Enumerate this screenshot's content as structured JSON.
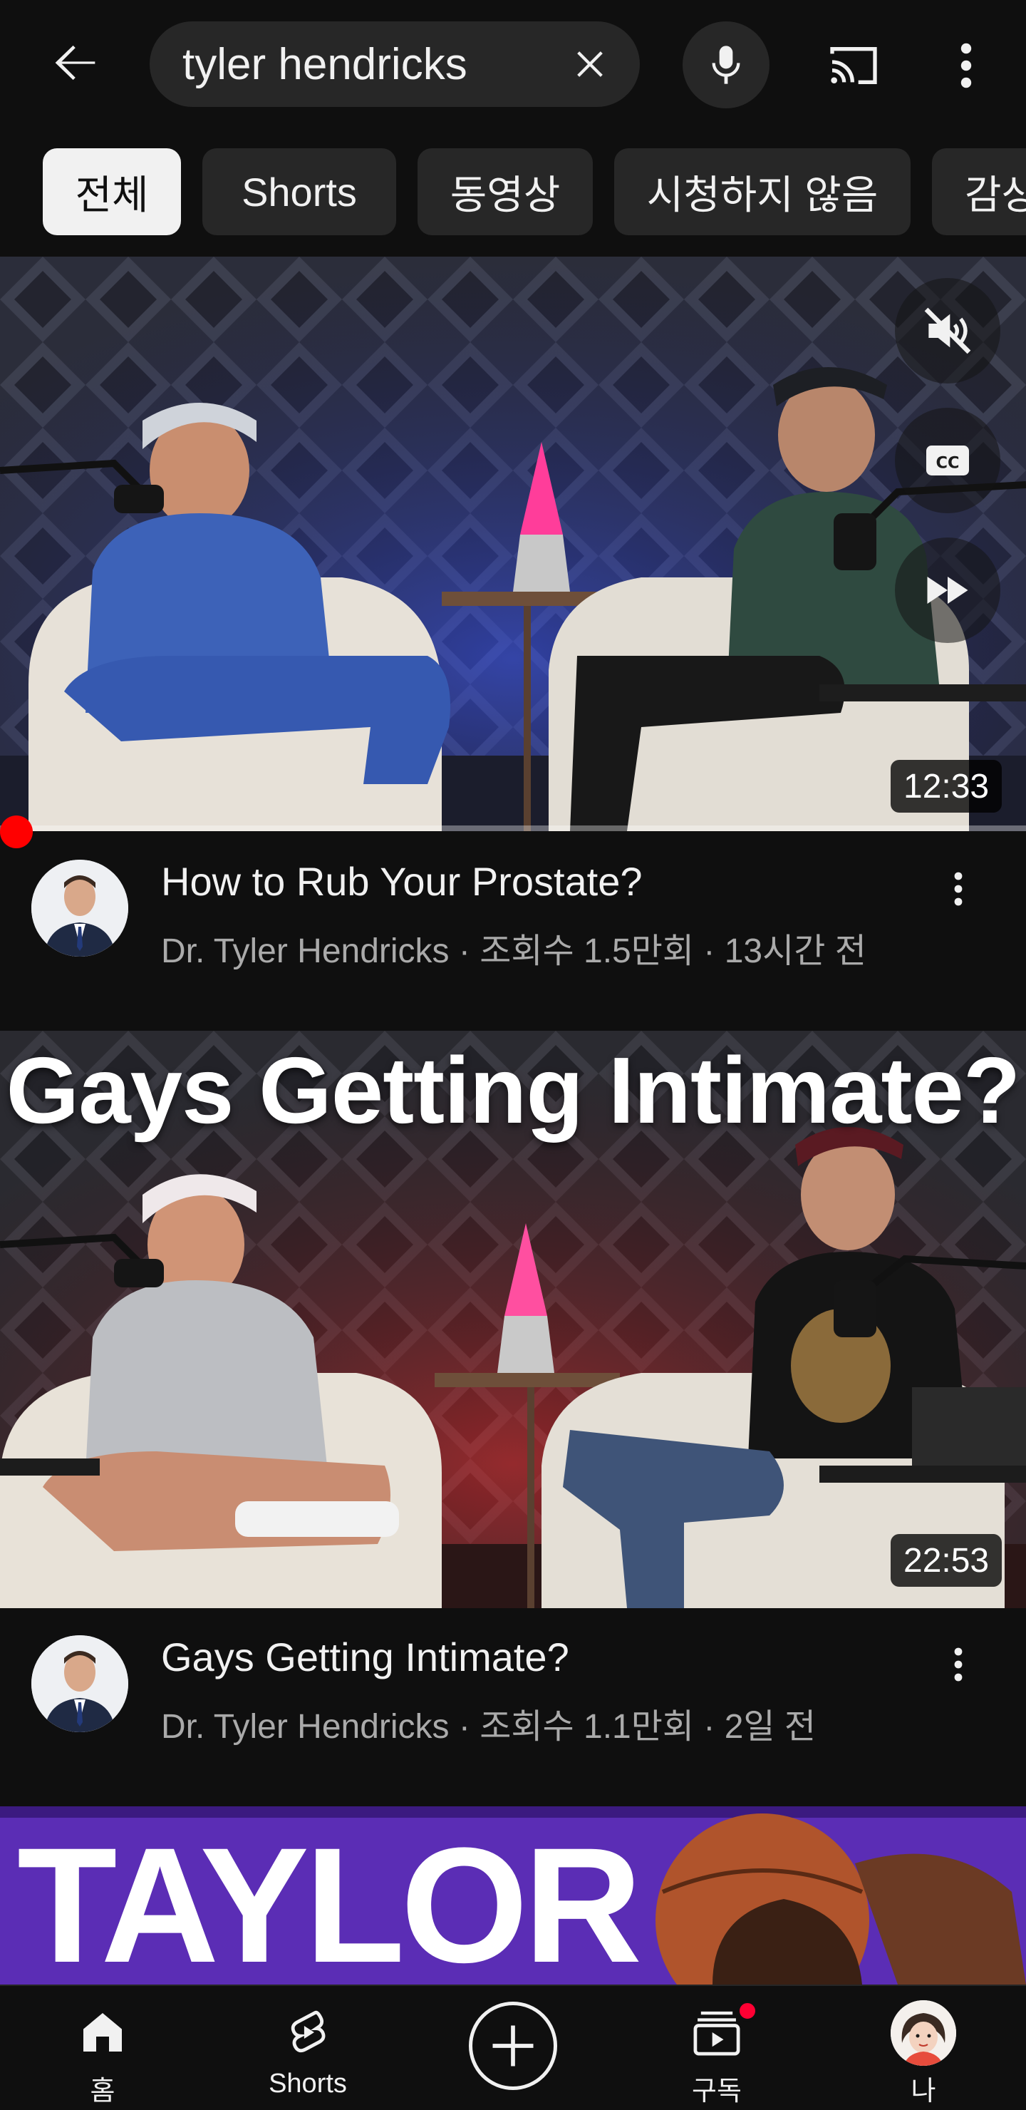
{
  "search": {
    "query": "tyler hendricks"
  },
  "chips": [
    {
      "label": "전체",
      "active": true
    },
    {
      "label": "Shorts",
      "active": false
    },
    {
      "label": "동영상",
      "active": false
    },
    {
      "label": "시청하지 않음",
      "active": false
    },
    {
      "label": "감상",
      "active": false
    }
  ],
  "videos": [
    {
      "title": "How to Rub Your Prostate?",
      "channel": "Dr. Tyler Hendricks",
      "meta": "Dr. Tyler Hendricks · 조회수 1.5만회 · 13시간 전",
      "duration": "12:33",
      "thumbnail_text": ""
    },
    {
      "title": "Gays Getting Intimate?",
      "channel": "Dr. Tyler Hendricks",
      "meta": "Dr. Tyler Hendricks · 조회수 1.1만회 · 2일 전",
      "duration": "22:53",
      "thumbnail_text": "Gays Getting Intimate?"
    },
    {
      "thumbnail_text": "TAYLOR"
    }
  ],
  "nav": {
    "home": "홈",
    "shorts": "Shorts",
    "subscriptions": "구독",
    "you": "나"
  },
  "colors": {
    "background": "#0f0f0f",
    "chip": "#272727",
    "accent_red": "#ff0000",
    "secondary_text": "#aaaaaa"
  },
  "icons": {
    "back": "arrow-left-icon",
    "clear": "close-icon",
    "mic": "microphone-icon",
    "cast": "cast-icon",
    "more": "more-vertical-icon",
    "mute": "volume-off-icon",
    "captions": "closed-captions-icon",
    "skip": "fast-forward-icon"
  }
}
